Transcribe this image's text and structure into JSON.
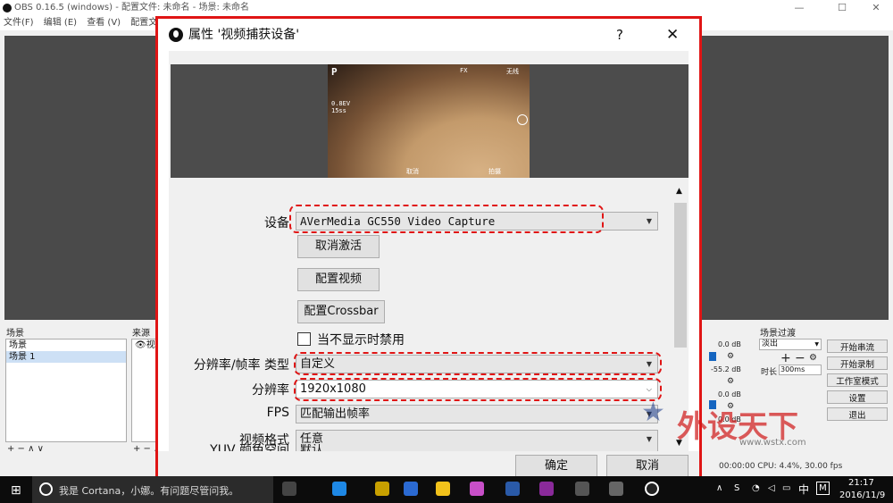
{
  "obs": {
    "title": "OBS 0.16.5 (windows) - 配置文件: 未命名 - 场景: 未命名",
    "menu": [
      "文件(F)",
      "编辑 (E)",
      "查看 (V)",
      "配置文件 (P)"
    ],
    "scenes_label": "场景",
    "sources_label": "来源",
    "scenes": [
      "场景",
      "场景 1"
    ],
    "source_partial": "视",
    "list_controls": "+ − ∧ ∨",
    "mixer_values": [
      "0.0 dB",
      "-55.2 dB",
      "0.0 dB",
      "0.0 dB"
    ],
    "transition_label": "场景过渡",
    "transition_value": "淡出",
    "duration_label": "时长",
    "duration_value": "300ms",
    "buttons": [
      "开始串流",
      "开始录制",
      "工作室模式",
      "设置",
      "退出"
    ],
    "status": "00:00:00   CPU: 4.4%, 30.00 fps"
  },
  "dialog": {
    "title": "属性 '视频捕获设备'",
    "help": "?",
    "close": "✕",
    "device_label": "设备",
    "device_value": "AVerMedia GC550 Video Capture",
    "deactivate": "取消激活",
    "configure_video": "配置视频",
    "configure_crossbar": "配置Crossbar",
    "disable_hidden": "当不显示时禁用",
    "res_type_label": "分辨率/帧率 类型",
    "res_type_value": "自定义",
    "resolution_label": "分辨率",
    "resolution_value": "1920x1080",
    "fps_label": "FPS",
    "fps_value": "匹配输出帧率",
    "video_format_label": "视频格式",
    "video_format_value": "任意",
    "yuv_label": "YUV 颜色空间",
    "yuv_value": "默认",
    "ok": "确定",
    "cancel": "取消",
    "cam_overlay": {
      "p": "P",
      "tl": "FX",
      "tr": "无线",
      "left1": "0.8EV",
      "left2": "15ss",
      "bottom": "取消",
      "bottom_right": "拍摄"
    }
  },
  "taskbar": {
    "cortana": "我是 Cortana，小娜。有问题尽管问我。",
    "ime": "中",
    "time": "21:17",
    "date": "2016/11/9"
  },
  "watermark": {
    "text": "外设天下",
    "url": "www.wstx.com"
  }
}
